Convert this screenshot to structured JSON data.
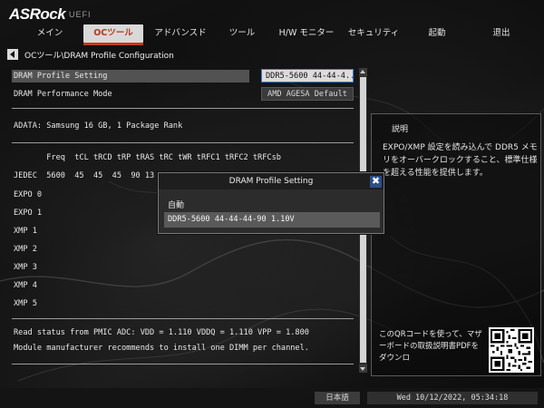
{
  "brand": {
    "logo": "ASRock",
    "sub": "UEFI"
  },
  "tabs": [
    {
      "label": "メイン",
      "active": false
    },
    {
      "label": "OCツール",
      "active": true
    },
    {
      "label": "アドバンスド",
      "active": false
    },
    {
      "label": "ツール",
      "active": false
    },
    {
      "label": "H/W モニター",
      "active": false
    },
    {
      "label": "セキュリティ",
      "active": false
    },
    {
      "label": "起動",
      "active": false
    },
    {
      "label": "退出",
      "active": false
    }
  ],
  "breadcrumb": "OCツール\\DRAM Profile Configuration",
  "settings": {
    "profile_label": "DRAM Profile Setting",
    "profile_value": "DDR5-5600 44-44-4...",
    "perf_label": "DRAM Performance Mode",
    "perf_value": "AMD AGESA Default"
  },
  "memory_info": "ADATA: Samsung 16 GB, 1 Package Rank",
  "timing_header": "       Freq  tCL tRCD tRP tRAS tRC tWR tRFC1 tRFC2 tRFCsb",
  "timing_rows": {
    "jedec": "JEDEC  5600  45  45  45  90 13",
    "expo0": "EXPO 0",
    "expo1": "EXPO 1",
    "xmp1": "XMP 1",
    "xmp2": "XMP 2",
    "xmp3": "XMP 3",
    "xmp4": "XMP 4",
    "xmp5": "XMP 5"
  },
  "status": {
    "pmic": "Read status from PMIC ADC: VDD = 1.110 VDDQ = 1.110 VPP = 1.800",
    "dimm_note": "Module manufacturer recommends to install one DIMM per channel."
  },
  "help": {
    "title": "説明",
    "body": "EXPO/XMP 設定を読み込んで DDR5 メモリをオーバークロックすること、標準仕様を超える性能を提供します。",
    "qr_text": "このQRコードを使って、マザーボードの取扱説明書PDFをダウンロ"
  },
  "modal": {
    "title": "DRAM Profile Setting",
    "close": "✖",
    "options": [
      "自動",
      "DDR5-5600 44-44-44-90 1.10V"
    ]
  },
  "footer": {
    "language": "日本語",
    "datetime": "Wed 10/12/2022, 05:34:18"
  }
}
